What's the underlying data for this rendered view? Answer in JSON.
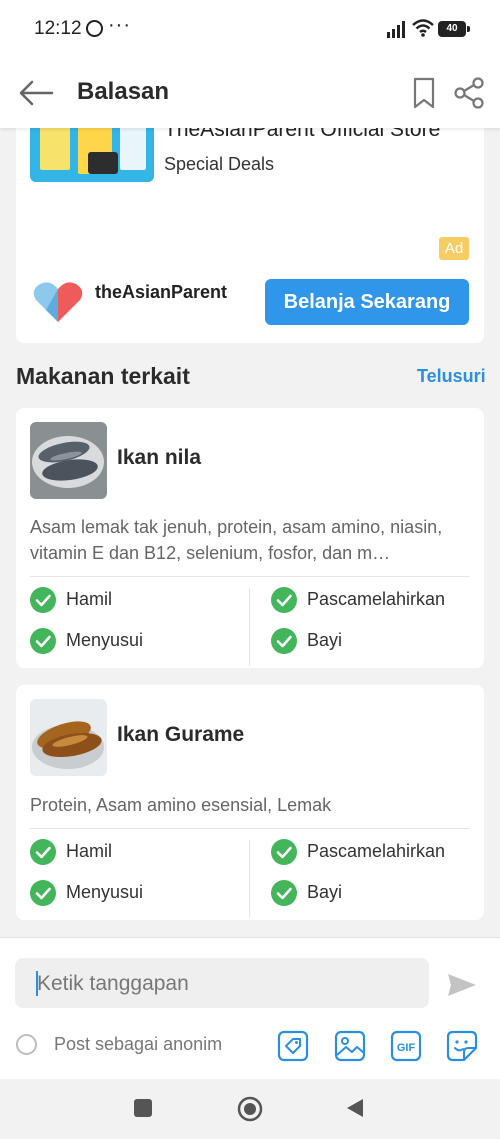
{
  "status": {
    "time": "12:12",
    "battery": "40"
  },
  "header": {
    "title": "Balasan"
  },
  "ad": {
    "store_name": "TheAsianParent Official Store",
    "subtitle": "Special Deals",
    "badge": "Ad",
    "brand": "theAsianParent",
    "cta": "Belanja Sekarang"
  },
  "section": {
    "title": "Makanan terkait",
    "link": "Telusuri"
  },
  "foods": [
    {
      "name": "Ikan nila",
      "description": "Asam lemak tak jenuh, protein, asam amino, niasin, vitamin E dan B12, selenium, fosfor, dan m…",
      "stages": [
        "Hamil",
        "Pascamelahirkan",
        "Menyusui",
        "Bayi"
      ]
    },
    {
      "name": "Ikan Gurame",
      "description": "Protein, Asam amino esensial, Lemak",
      "stages": [
        "Hamil",
        "Pascamelahirkan",
        "Menyusui",
        "Bayi"
      ]
    }
  ],
  "composer": {
    "placeholder": "Ketik tanggapan",
    "anon_label": "Post sebagai anonim",
    "gif_label": "GIF"
  },
  "colors": {
    "accent": "#2f96ea",
    "check": "#43b55a",
    "ad_badge": "#f7cc63"
  }
}
